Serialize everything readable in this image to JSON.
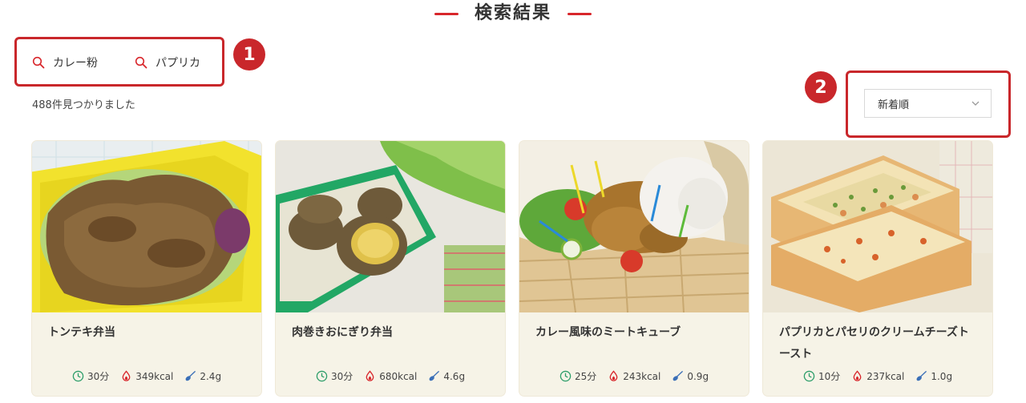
{
  "header": {
    "title": "検索結果"
  },
  "search_tags": [
    {
      "label": "カレー粉"
    },
    {
      "label": "パプリカ"
    }
  ],
  "callouts": [
    "1",
    "2"
  ],
  "result_count": "488件見つかりました",
  "sort": {
    "selected": "新着順"
  },
  "colors": {
    "accent": "#c9272b",
    "card_bg": "#f6f3e7",
    "time_icon": "#2e9e6a",
    "kcal_icon": "#d8262b",
    "salt_icon": "#3a6fb7"
  },
  "recipes": [
    {
      "title": "トンテキ弁当",
      "time": "30分",
      "kcal": "349kcal",
      "salt": "2.4g"
    },
    {
      "title": "肉巻きおにぎり弁当",
      "time": "30分",
      "kcal": "680kcal",
      "salt": "4.6g"
    },
    {
      "title": "カレー風味のミートキューブ",
      "time": "25分",
      "kcal": "243kcal",
      "salt": "0.9g"
    },
    {
      "title": "パプリカとパセリのクリームチーズトースト",
      "time": "10分",
      "kcal": "237kcal",
      "salt": "1.0g"
    }
  ]
}
